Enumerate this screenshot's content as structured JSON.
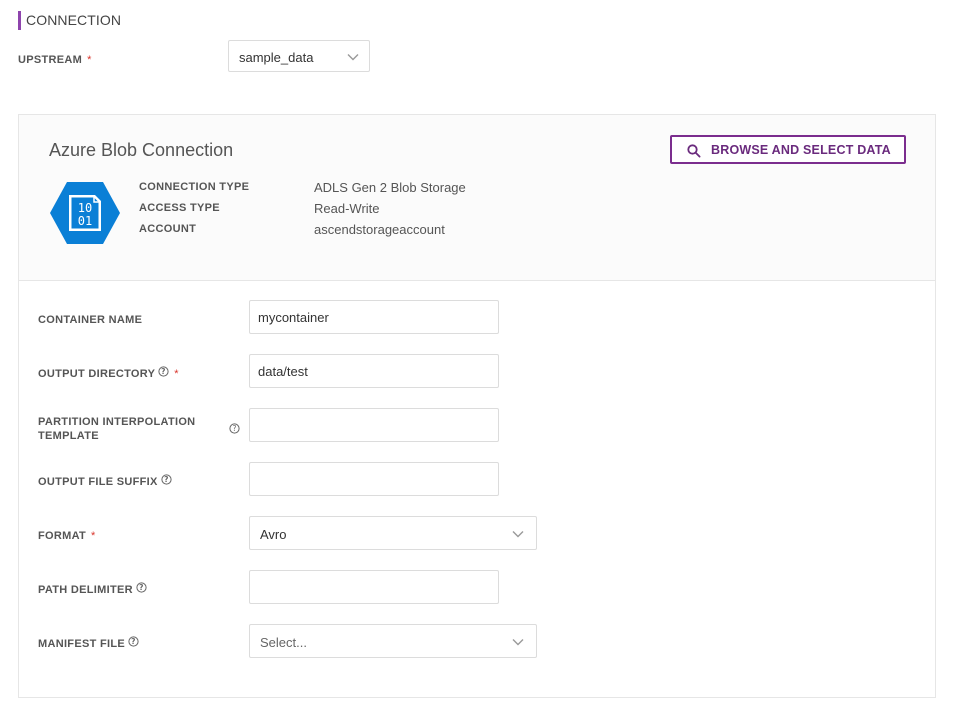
{
  "section": {
    "title": "CONNECTION"
  },
  "upstream": {
    "label": "UPSTREAM",
    "required": "*",
    "value": "sample_data"
  },
  "connection": {
    "title": "Azure Blob Connection",
    "browse_label": "BROWSE AND SELECT DATA",
    "icon_text_line1": "10",
    "icon_text_line2": "01",
    "details": [
      {
        "key": "CONNECTION TYPE",
        "value": "ADLS Gen 2 Blob Storage"
      },
      {
        "key": "ACCESS TYPE",
        "value": "Read-Write"
      },
      {
        "key": "ACCOUNT",
        "value": "ascendstorageaccount"
      }
    ]
  },
  "form": {
    "container_name": {
      "label": "CONTAINER NAME",
      "value": "mycontainer"
    },
    "output_directory": {
      "label": "OUTPUT DIRECTORY",
      "required": "*",
      "value": "data/test"
    },
    "partition_template": {
      "label_line1": "PARTITION INTERPOLATION",
      "label_line2": "TEMPLATE",
      "value": ""
    },
    "output_file_suffix": {
      "label": "OUTPUT FILE SUFFIX",
      "value": ""
    },
    "format": {
      "label": "FORMAT",
      "required": "*",
      "value": "Avro"
    },
    "path_delimiter": {
      "label": "PATH DELIMITER",
      "value": ""
    },
    "manifest_file": {
      "label": "MANIFEST FILE",
      "placeholder": "Select..."
    }
  },
  "colors": {
    "accent": "#8e44ad",
    "button_border": "#7b2d8e",
    "azure_blue": "#0a7fd6",
    "required": "#d9342b"
  }
}
